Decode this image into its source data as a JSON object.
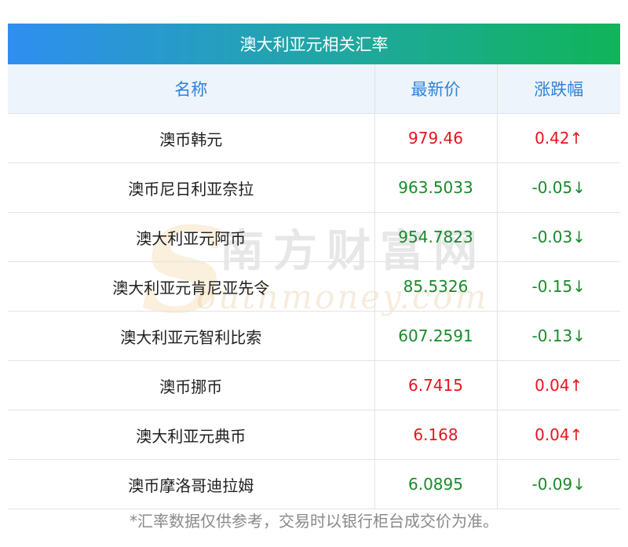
{
  "table": {
    "title": "澳大利亚元相关汇率",
    "headers": {
      "name": "名称",
      "price": "最新价",
      "change": "涨跌幅"
    },
    "rows": [
      {
        "name": "澳币韩元",
        "price": "979.46",
        "change": "0.42↑",
        "direction": "up"
      },
      {
        "name": "澳币尼日利亚奈拉",
        "price": "963.5033",
        "change": "-0.05↓",
        "direction": "down"
      },
      {
        "name": "澳大利亚元阿币",
        "price": "954.7823",
        "change": "-0.03↓",
        "direction": "down"
      },
      {
        "name": "澳大利亚元肯尼亚先令",
        "price": "85.5326",
        "change": "-0.15↓",
        "direction": "down"
      },
      {
        "name": "澳大利亚元智利比索",
        "price": "607.2591",
        "change": "-0.13↓",
        "direction": "down"
      },
      {
        "name": "澳币挪币",
        "price": "6.7415",
        "change": "0.04↑",
        "direction": "up"
      },
      {
        "name": "澳大利亚元典币",
        "price": "6.168",
        "change": "0.04↑",
        "direction": "up"
      },
      {
        "name": "澳币摩洛哥迪拉姆",
        "price": "6.0895",
        "change": "-0.09↓",
        "direction": "down"
      }
    ]
  },
  "footnote": "*汇率数据仅供参考，交易时以银行柜台成交价为准。",
  "watermark": {
    "letter": "S",
    "chinese": "南方财富网",
    "english": "outhmoney.com"
  },
  "colors": {
    "up": "#e8141c",
    "down": "#198a2a",
    "header_text": "#2f82d8",
    "header_bg": "#eef4fc",
    "title_gradient_start": "#2f8ef0",
    "title_gradient_end": "#10b45a"
  }
}
